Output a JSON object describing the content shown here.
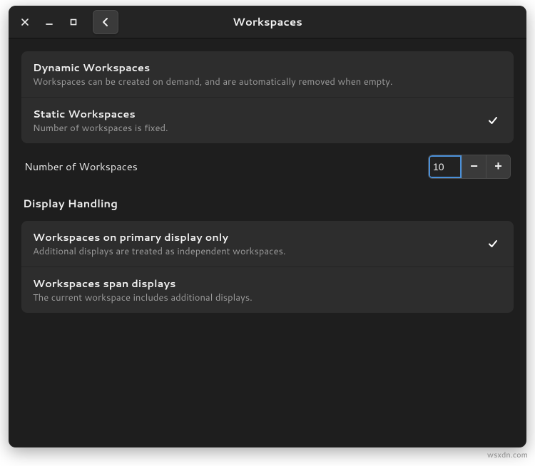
{
  "window": {
    "title": "Workspaces"
  },
  "workspaceMode": {
    "dynamic": {
      "title": "Dynamic Workspaces",
      "sub": "Workspaces can be created on demand, and are automatically removed when empty.",
      "selected": false
    },
    "static": {
      "title": "Static Workspaces",
      "sub": "Number of workspaces is fixed.",
      "selected": true
    }
  },
  "numberOfWorkspaces": {
    "label": "Number of Workspaces",
    "value": "10"
  },
  "displayHandlingHeader": "Display Handling",
  "displayHandling": {
    "primaryOnly": {
      "title": "Workspaces on primary display only",
      "sub": "Additional displays are treated as independent workspaces.",
      "selected": true
    },
    "span": {
      "title": "Workspaces span displays",
      "sub": "The current workspace includes additional displays.",
      "selected": false
    }
  },
  "watermark": "wsxdn.com"
}
